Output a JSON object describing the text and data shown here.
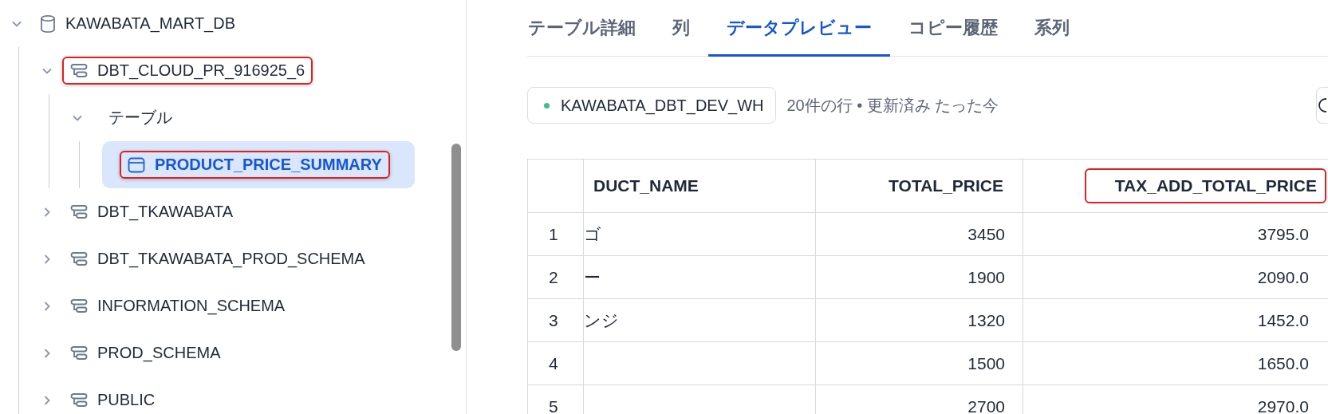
{
  "tree": [
    {
      "label": "KAWABATA_MART_DB",
      "kind": "database",
      "expanded": true,
      "selected": false,
      "annotated": false,
      "children": [
        {
          "label": "DBT_CLOUD_PR_916925_6",
          "kind": "schema",
          "expanded": true,
          "selected": false,
          "annotated": true,
          "children": [
            {
              "label": "テーブル",
              "kind": "folder",
              "expanded": true,
              "selected": false,
              "annotated": false,
              "children": [
                {
                  "label": "PRODUCT_PRICE_SUMMARY",
                  "kind": "table",
                  "selected": true,
                  "annotated": true
                }
              ]
            }
          ]
        },
        {
          "label": "DBT_TKAWABATA",
          "kind": "schema",
          "expanded": false,
          "selected": false,
          "annotated": false
        },
        {
          "label": "DBT_TKAWABATA_PROD_SCHEMA",
          "kind": "schema",
          "expanded": false,
          "selected": false,
          "annotated": false
        },
        {
          "label": "INFORMATION_SCHEMA",
          "kind": "schema",
          "expanded": false,
          "selected": false,
          "annotated": false
        },
        {
          "label": "PROD_SCHEMA",
          "kind": "schema",
          "expanded": false,
          "selected": false,
          "annotated": false
        },
        {
          "label": "PUBLIC",
          "kind": "schema",
          "expanded": false,
          "selected": false,
          "annotated": false
        }
      ]
    }
  ],
  "tabs": [
    {
      "label": "テーブル詳細",
      "selected": false
    },
    {
      "label": "列",
      "selected": false
    },
    {
      "label": "データプレビュー",
      "selected": true
    },
    {
      "label": "コピー履歴",
      "selected": false
    },
    {
      "label": "系列",
      "selected": false
    }
  ],
  "warehouse": {
    "name": "KAWABATA_DBT_DEV_WH",
    "color": "#3dbf8a"
  },
  "summary": "20件の行 • 更新済み たった今",
  "table": {
    "columns": [
      {
        "label": "DUCT_NAME",
        "kind": "text",
        "annotated": false
      },
      {
        "label": "TOTAL_PRICE",
        "kind": "number",
        "annotated": false
      },
      {
        "label": "TAX_ADD_TOTAL_PRICE",
        "kind": "number",
        "annotated": true
      }
    ],
    "rows": [
      {
        "index": "1",
        "cells": [
          "ゴ",
          "3450",
          "3795.0"
        ]
      },
      {
        "index": "2",
        "cells": [
          "ー",
          "1900",
          "2090.0"
        ]
      },
      {
        "index": "3",
        "cells": [
          "ンジ",
          "1320",
          "1452.0"
        ]
      },
      {
        "index": "4",
        "cells": [
          null,
          "1500",
          "1650.0"
        ]
      },
      {
        "index": "5",
        "cells": [
          null,
          "2700",
          "2970.0"
        ]
      }
    ]
  }
}
